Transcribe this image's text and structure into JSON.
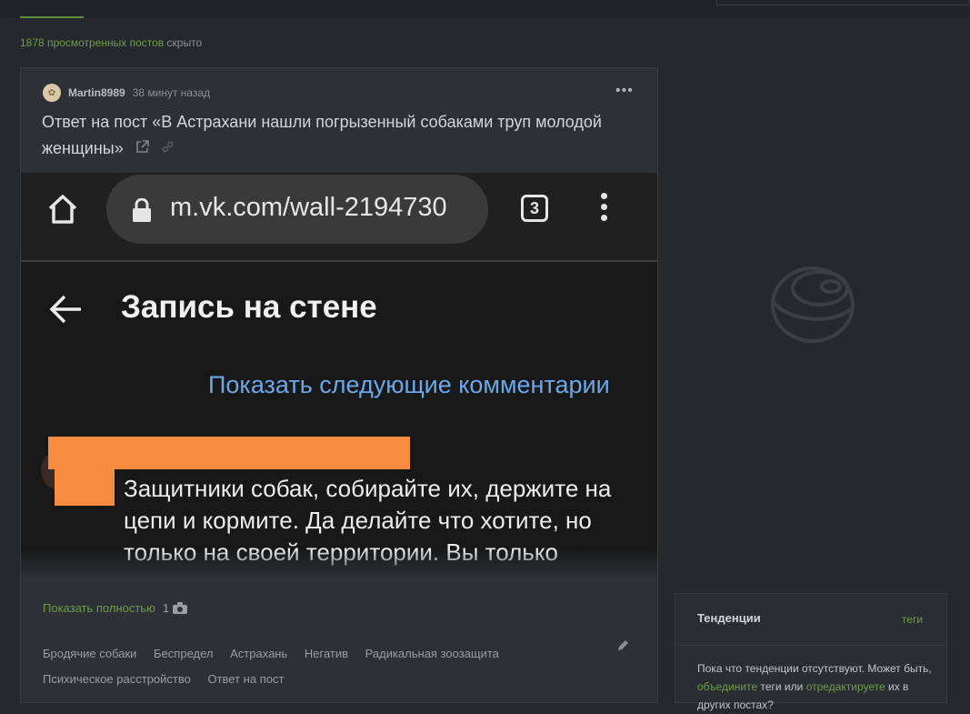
{
  "viewed": {
    "count_text": "1878 просмотренных постов",
    "hidden_text": "скрыто"
  },
  "post": {
    "author": "Martin8989",
    "time": "38 минут назад",
    "more_icon": "more-dots-icon",
    "title": "Ответ на пост «В Астрахани нашли погрызенный собаками труп молодой женщины»",
    "screenshot": {
      "url": "m.vk.com/wall-2194730",
      "tabs_count": "3",
      "page_title": "Запись на стене",
      "show_next": "Показать следующие комментарии",
      "comment": "Защитники собак, собирайте их, держите на цепи и кормите. Да делайте что хотите, но только на своей территории. Вы только"
    },
    "show_full": "Показать полностью",
    "image_count": "1",
    "tags": [
      "Бродячие собаки",
      "Беспредел",
      "Астрахань",
      "Негатив",
      "Радикальная зоозащита",
      "Психическое расстройство",
      "Ответ на пост"
    ]
  },
  "trends": {
    "title": "Тенденции",
    "tags_link": "теги",
    "text_before": "Пока что тенденции отсутствуют. Может быть,",
    "link1": "объедините",
    "text_middle": "теги или",
    "link2": "отредактируете",
    "text_after": "их в других постах?"
  },
  "colors": {
    "accent": "#6e9d4a",
    "link_blue": "#6aa8e9",
    "redaction": "#f78c40"
  }
}
